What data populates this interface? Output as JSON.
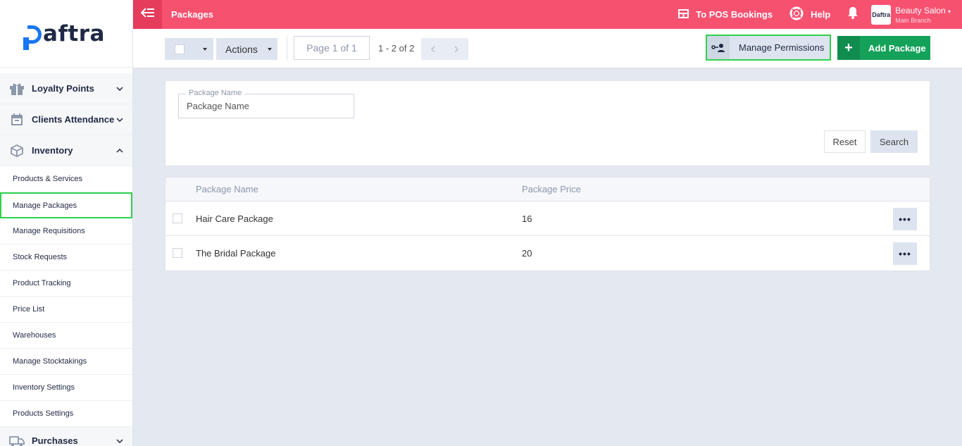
{
  "brand": {
    "name": "Daftra",
    "logo_rest": "aftra"
  },
  "topbar": {
    "title": "Packages",
    "pos_label": "To POS Bookings",
    "help_label": "Help",
    "account_name": "Beauty Salon",
    "account_branch": "Main Branch",
    "account_logo_text": "Daftra"
  },
  "sidebar": {
    "items": [
      {
        "label": "Loyalty Points",
        "icon": "gift-icon"
      },
      {
        "label": "Clients Attendance",
        "icon": "calendar-icon"
      },
      {
        "label": "Inventory",
        "icon": "box-icon"
      }
    ],
    "inventory_sub": [
      "Products & Services",
      "Manage Packages",
      "Manage Requisitions",
      "Stock Requests",
      "Product Tracking",
      "Price List",
      "Warehouses",
      "Manage Stocktakings",
      "Inventory Settings",
      "Products Settings"
    ],
    "active_sub": "Manage Packages",
    "bottom_item": {
      "label": "Purchases",
      "icon": "truck-icon"
    }
  },
  "toolbar": {
    "actions_label": "Actions",
    "page_label": "Page 1 of 1",
    "range_label": "1 - 2 of 2",
    "permissions_label": "Manage Permissions",
    "add_label": "Add Package"
  },
  "filter": {
    "package_name_label": "Package Name",
    "package_name_placeholder": "Package Name",
    "reset_label": "Reset",
    "search_label": "Search"
  },
  "table": {
    "columns": [
      "Package Name",
      "Package Price"
    ],
    "rows": [
      {
        "name": "Hair Care Package",
        "price": "16"
      },
      {
        "name": "The Bridal Package",
        "price": "20"
      }
    ],
    "more_label": "•••"
  },
  "colors": {
    "topbar": "#f75170",
    "accent_green": "#14a159",
    "highlight": "#2dd24b",
    "brand_blue": "#1877f2"
  }
}
